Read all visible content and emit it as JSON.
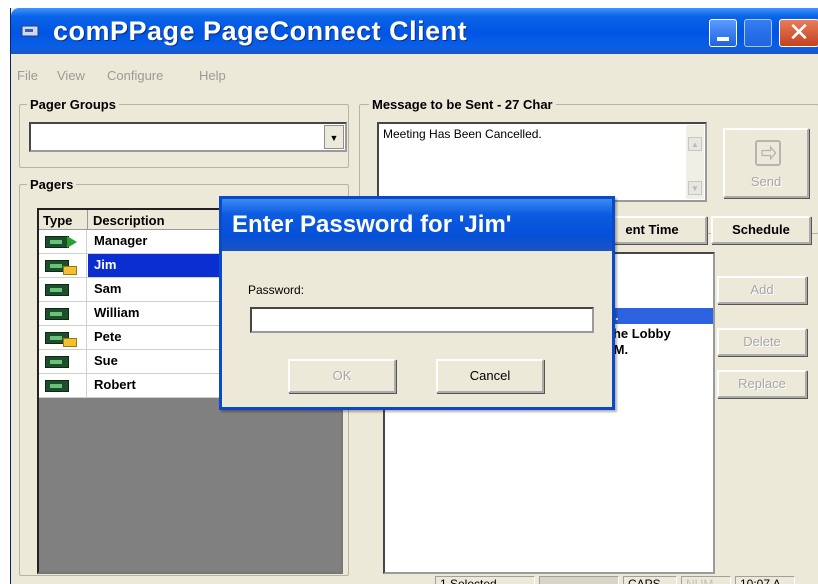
{
  "window": {
    "title": "comPPage PageConnect Client",
    "close_glyph": "✕"
  },
  "menu": [
    "File",
    "View",
    "Configure",
    "Help"
  ],
  "pager_groups": {
    "title": "Pager Groups",
    "selected": ""
  },
  "pagers": {
    "title": "Pagers",
    "columns": [
      "Type",
      "Description"
    ],
    "rows": [
      {
        "name": "Manager",
        "icon": "pager-send-icon"
      },
      {
        "name": "Jim",
        "icon": "pager-locked-icon",
        "selected": true
      },
      {
        "name": "Sam",
        "icon": "pager-icon"
      },
      {
        "name": "William",
        "icon": "pager-icon"
      },
      {
        "name": "Pete",
        "icon": "pager-locked-icon"
      },
      {
        "name": "Sue",
        "icon": "pager-icon"
      },
      {
        "name": "Robert",
        "icon": "pager-icon"
      }
    ]
  },
  "message": {
    "title": "Message to be Sent - 27 Char",
    "text": "Meeting Has Been Cancelled."
  },
  "buttons": {
    "send": "Send",
    "sent_time": "ent Time",
    "schedule": "Schedule",
    "add": "Add",
    "delete": "Delete",
    "replace": "Replace"
  },
  "canned_messages": {
    "selected_fragment": "d.",
    "line2": "The Lobby",
    "line3": "PM."
  },
  "status": {
    "selected": "1 Selected",
    "caps": "CAPS",
    "num": "NUM",
    "time": "10:07 A"
  },
  "dialog": {
    "title": "Enter Password for 'Jim'",
    "label": "Password:",
    "value": "",
    "ok": "OK",
    "cancel": "Cancel"
  },
  "colors": {
    "title_blue": "#0055e5",
    "selection_blue": "#0b2ed1",
    "window_bg": "#ece9d8"
  }
}
